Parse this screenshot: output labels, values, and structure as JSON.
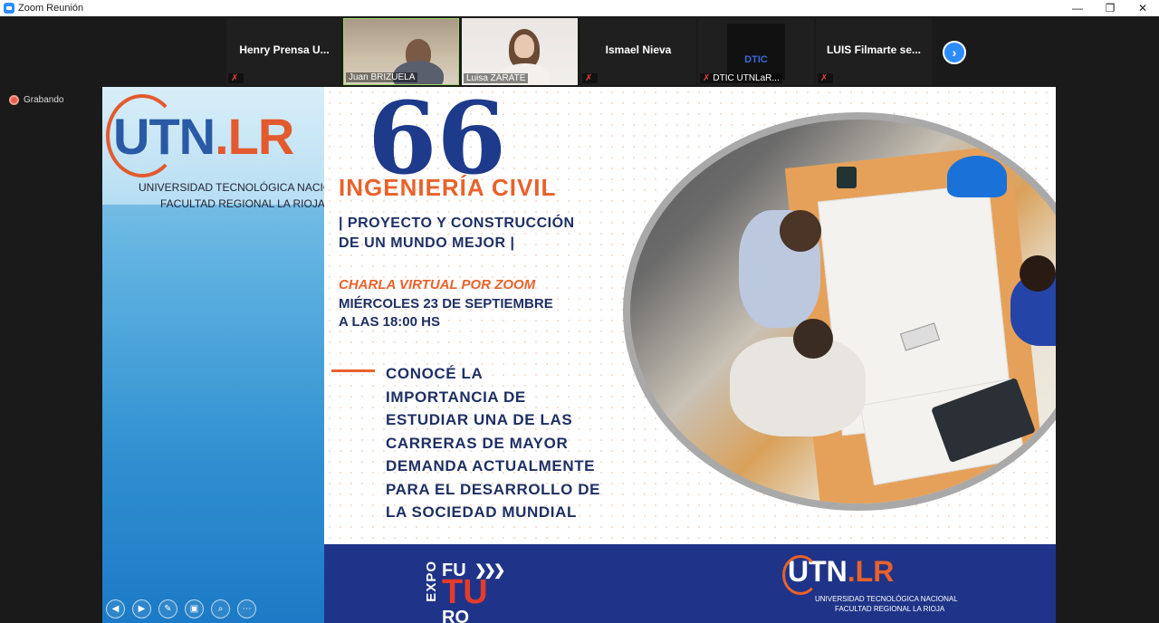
{
  "window": {
    "title": "Zoom Reunión",
    "controls": [
      "—",
      "❐",
      "✕"
    ]
  },
  "participants": [
    {
      "name": "Henry Prensa U...",
      "label": "",
      "muted": true,
      "video": false
    },
    {
      "name": "",
      "label": "Juan BRIZUELA",
      "muted": false,
      "video": true
    },
    {
      "name": "",
      "label": "Luisa ZARATE",
      "muted": false,
      "video": true
    },
    {
      "name": "Ismael Nieva",
      "label": "",
      "muted": true,
      "video": false
    },
    {
      "name": "",
      "label": "DTIC UTNLaR...",
      "muted": true,
      "video": false,
      "logo": "DTIC"
    },
    {
      "name": "LUIS Filmarte se...",
      "label": "",
      "muted": true,
      "video": false
    }
  ],
  "recording": {
    "label": "Grabando"
  },
  "slide": {
    "logo_main": "UTN",
    "logo_lr": ".LR",
    "university_line1": "UNIVERSIDAD TECNOLÓGICA NACIONAL",
    "university_line2": "FACULTAD REGIONAL LA RIOJA",
    "quote_mark": "66",
    "career": "INGENIERÍA CIVIL",
    "slogan_line1": "| PROYECTO Y CONSTRUCCIÓN",
    "slogan_line2": "DE UN MUNDO MEJOR |",
    "talk": "CHARLA VIRTUAL POR ZOOM",
    "date_line1": "MIÉRCOLES 23 DE SEPTIEMBRE",
    "date_line2": "A LAS 18:00 HS",
    "body_lines": [
      "CONOCÉ LA",
      "IMPORTANCIA DE",
      "ESTUDIAR UNA DE LAS",
      "CARRERAS DE MAYOR",
      "DEMANDA ACTUALMENTE",
      "PARA EL DESARROLLO DE",
      "LA SOCIEDAD MUNDIAL"
    ],
    "expo_vertical": "EXPO",
    "expo_fu": "FU",
    "expo_tu": "TU",
    "expo_ro": "RO",
    "footer_logo_main": "UTN",
    "footer_logo_lr": ".LR",
    "footer_line1": "UNIVERSIDAD TECNOLÓGICA NACIONAL",
    "footer_line2": "FACULTAD REGIONAL LA RIOJA"
  },
  "colors": {
    "accent": "#e8622b",
    "navy": "#1e2f63",
    "zoom_blue": "#2d8cff"
  }
}
